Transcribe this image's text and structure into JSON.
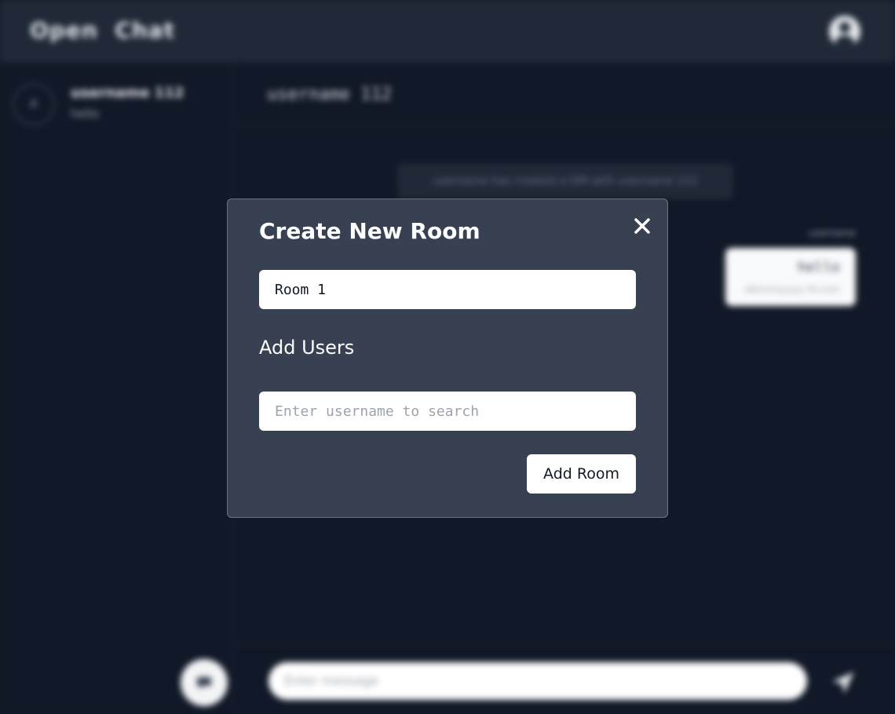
{
  "app": {
    "brand": "Open  Chat"
  },
  "sidebar": {
    "rooms": [
      {
        "avatar_letter": "A",
        "name": "username 112",
        "last_message": "hello"
      }
    ],
    "new_room_icon": "chat-plus-icon"
  },
  "chat": {
    "title": "username 112",
    "system_message": "username has created a DM with username 112",
    "messages": [
      {
        "sender": "username",
        "text": "hello",
        "time": "dd/mm/yyyy hh:mm"
      }
    ],
    "composer_placeholder": "Enter message",
    "send_icon": "paper-plane-icon"
  },
  "modal": {
    "title": "Create New Room",
    "close_icon": "close-icon",
    "room_name_value": "Room 1",
    "add_users_label": "Add Users",
    "user_search_placeholder": "Enter username to search",
    "add_room_label": "Add Room"
  },
  "colors": {
    "page_background": "#111827",
    "topbar_background": "#1f2937",
    "modal_background": "#374151",
    "modal_border": "#6b7280",
    "input_background": "#ffffff"
  }
}
